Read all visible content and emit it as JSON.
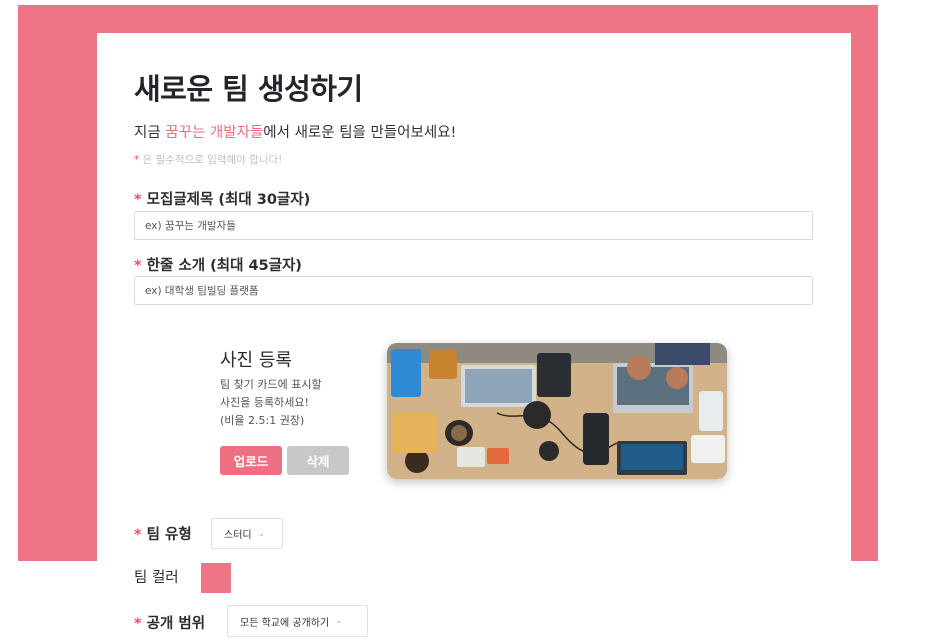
{
  "header": {
    "title": "새로운 팀 생성하기",
    "subtitle_pre": "지금 ",
    "subtitle_highlight": "꿈꾸는 개발자들",
    "subtitle_post": "에서 새로운 팀을 만들어보세요!",
    "required_note_star": "*",
    "required_note": " 은 필수적으로 입력해야 합니다!"
  },
  "fields": {
    "title_field": {
      "star": "*",
      "label": " 모집글제목 (최대 30글자)",
      "placeholder": "ex) 꿈꾸는 개발자들"
    },
    "intro_field": {
      "star": "*",
      "label": " 한줄 소개 (최대 45글자)",
      "placeholder": "ex) 대학생 팀빌딩 플랫폼"
    }
  },
  "photo": {
    "title": "사진 등록",
    "desc_line1": "팀 찾기 카드에 표시할",
    "desc_line2": "사진을 등록하세요!",
    "desc_line3": "(비율 2.5:1 권장)",
    "upload_label": "업로드",
    "delete_label": "삭제",
    "image_icon": "team-workspace-photo"
  },
  "team_type": {
    "star": "*",
    "label": " 팀 유형",
    "selected": "스터디",
    "chevron": "⌄"
  },
  "team_color": {
    "label": "팀 컬러",
    "color": "#ee7586"
  },
  "visibility": {
    "star": "*",
    "label": " 공개 범위",
    "selected": "모든 학교에 공개하기",
    "chevron": "⌄"
  },
  "colors": {
    "accent": "#ee7586",
    "button_primary": "#ee6f82",
    "button_secondary": "#c8c8c8"
  }
}
